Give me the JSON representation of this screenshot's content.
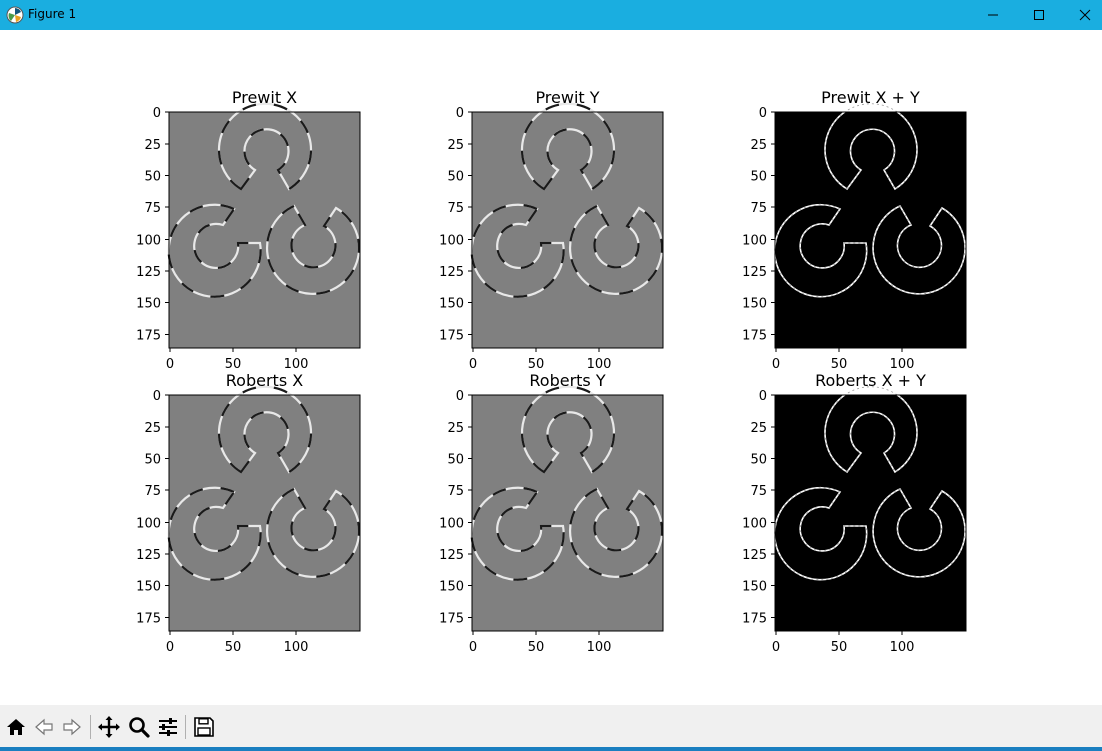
{
  "window": {
    "title": "Figure 1",
    "accent": "#1aaee0"
  },
  "window_controls": {
    "minimize_icon": "minimize-icon",
    "maximize_icon": "maximize-icon",
    "close_icon": "close-icon"
  },
  "toolbar": {
    "icons": [
      "home-icon",
      "back-arrow-icon",
      "forward-arrow-icon",
      "pan-icon",
      "zoom-icon",
      "configure-subplots-icon",
      "save-icon"
    ]
  },
  "subplots": [
    {
      "title": "Prewit X",
      "style": "gray"
    },
    {
      "title": "Prewit Y",
      "style": "gray"
    },
    {
      "title": "Prewit X + Y",
      "style": "black"
    },
    {
      "title": "Roberts X",
      "style": "gray"
    },
    {
      "title": "Roberts Y",
      "style": "gray"
    },
    {
      "title": "Roberts X + Y",
      "style": "black"
    }
  ],
  "axes": {
    "yticks": [
      "0",
      "25",
      "50",
      "75",
      "100",
      "125",
      "150",
      "175"
    ],
    "xticks": [
      "0",
      "50",
      "100"
    ]
  }
}
